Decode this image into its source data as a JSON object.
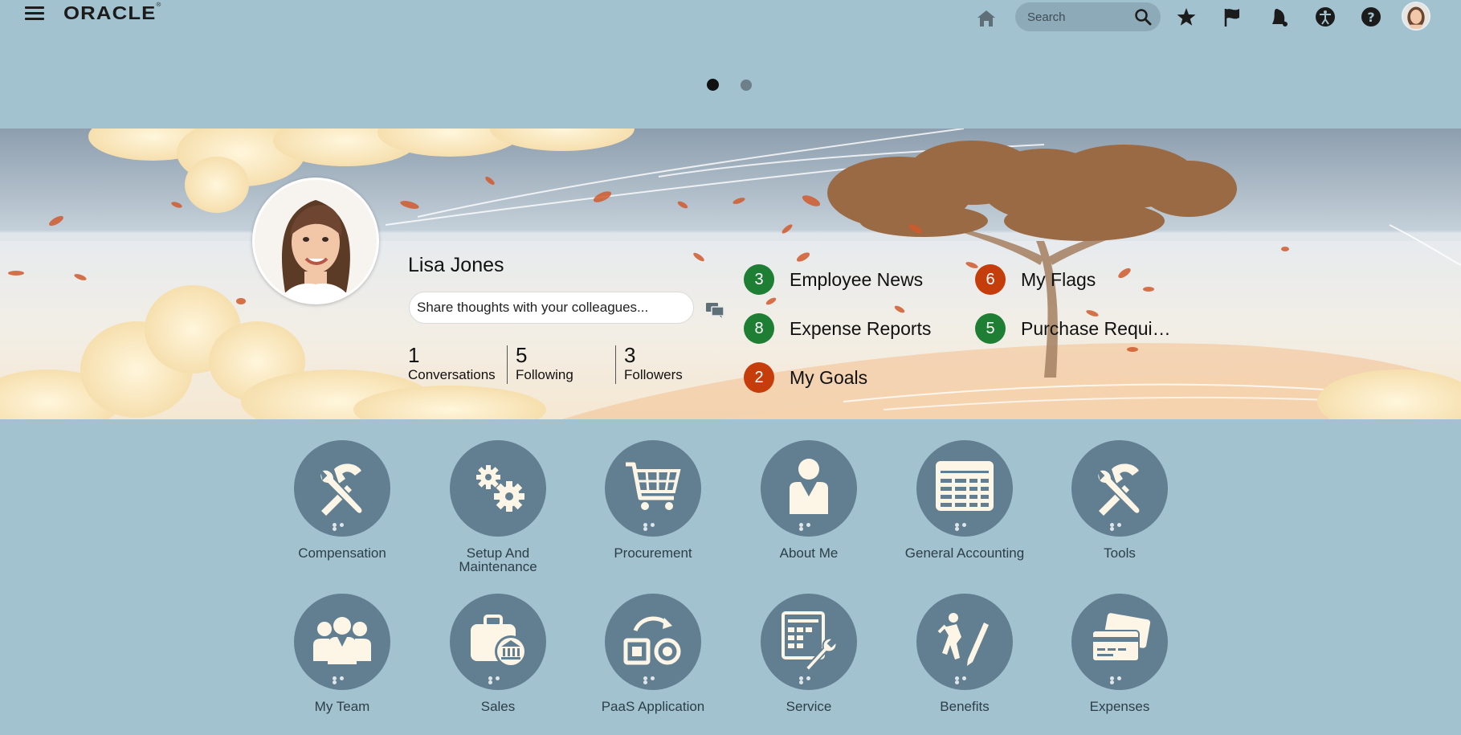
{
  "header": {
    "logo_text": "ORACLE",
    "search_placeholder": "Search",
    "icons": [
      "hamburger-icon",
      "home-icon",
      "search-icon",
      "favorites-star-icon",
      "watchlist-flag-icon",
      "notifications-bell-icon",
      "accessibility-icon",
      "help-icon",
      "user-avatar"
    ]
  },
  "carousel": {
    "pages": 2,
    "active_page": 1
  },
  "profile": {
    "name": "Lisa Jones",
    "share_placeholder": "Share thoughts with your colleagues...",
    "stats": [
      {
        "value": "1",
        "label": "Conversations"
      },
      {
        "value": "5",
        "label": "Following"
      },
      {
        "value": "3",
        "label": "Followers"
      }
    ]
  },
  "quick_links": [
    {
      "count": "3",
      "label": "Employee News",
      "color": "#1e7e34"
    },
    {
      "count": "6",
      "label": "My Flags",
      "color": "#c43d0b"
    },
    {
      "count": "8",
      "label": "Expense Reports",
      "color": "#1e7e34"
    },
    {
      "count": "5",
      "label": "Purchase Requi…",
      "color": "#1e7e34"
    },
    {
      "count": "2",
      "label": "My Goals",
      "color": "#c43d0b"
    }
  ],
  "apps": [
    {
      "label": "Compensation",
      "icon": "tools-icon"
    },
    {
      "label": "Setup And Maintenance",
      "icon": "gears-icon"
    },
    {
      "label": "Procurement",
      "icon": "cart-icon"
    },
    {
      "label": "About Me",
      "icon": "person-icon"
    },
    {
      "label": "General Accounting",
      "icon": "ledger-icon"
    },
    {
      "label": "Tools",
      "icon": "tools-icon"
    },
    {
      "label": "My Team",
      "icon": "team-icon"
    },
    {
      "label": "Sales",
      "icon": "briefcase-bank-icon"
    },
    {
      "label": "PaaS Application",
      "icon": "paas-icon"
    },
    {
      "label": "Service",
      "icon": "service-icon"
    },
    {
      "label": "Benefits",
      "icon": "benefits-icon"
    },
    {
      "label": "Expenses",
      "icon": "credit-card-icon"
    }
  ],
  "colors": {
    "background": "#a3c2d0",
    "tile": "#627f92",
    "badge_green": "#1e7e34",
    "badge_orange": "#c43d0b"
  }
}
